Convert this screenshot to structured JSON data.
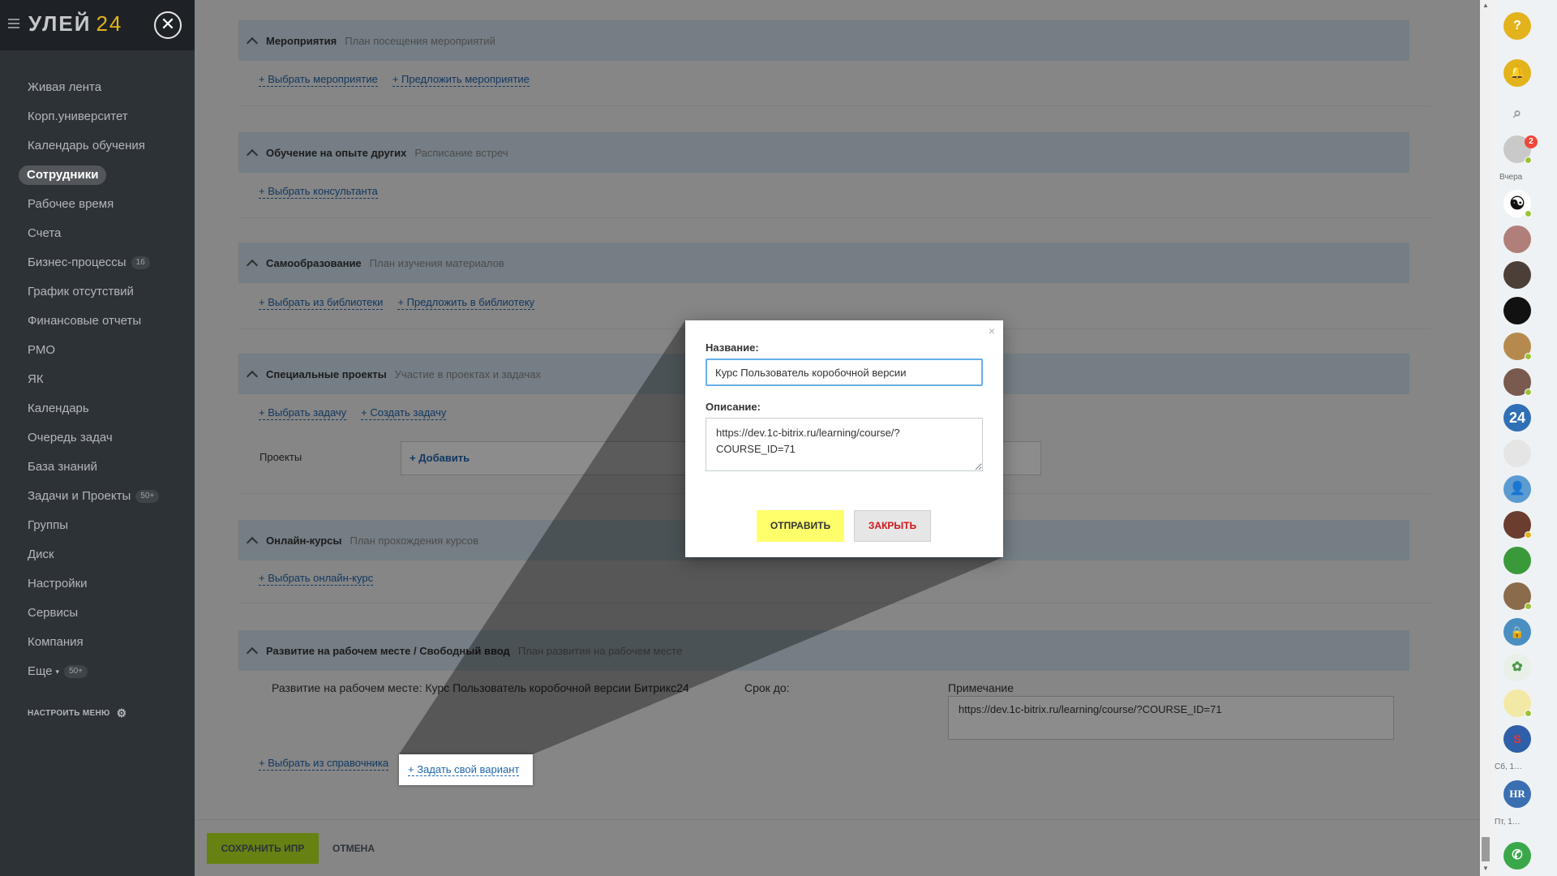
{
  "sidebar": {
    "logo_text": "УЛЕЙ",
    "logo_num": "24",
    "items": [
      {
        "label": "Живая лента"
      },
      {
        "label": "Корп.университет"
      },
      {
        "label": "Календарь обучения"
      },
      {
        "label": "Сотрудники",
        "active": true
      },
      {
        "label": "Рабочее время"
      },
      {
        "label": "Счета"
      },
      {
        "label": "Бизнес-процессы",
        "count": "16"
      },
      {
        "label": "График отсутствий"
      },
      {
        "label": "Финансовые отчеты"
      },
      {
        "label": "РМО"
      },
      {
        "label": "ЯК"
      },
      {
        "label": "Календарь"
      },
      {
        "label": "Очередь задач"
      },
      {
        "label": "База знаний"
      },
      {
        "label": "Задачи и Проекты",
        "count": "50+"
      },
      {
        "label": "Группы"
      },
      {
        "label": "Диск"
      },
      {
        "label": "Настройки"
      },
      {
        "label": "Сервисы"
      },
      {
        "label": "Компания"
      },
      {
        "label": "Еще",
        "count": "50+",
        "arrow": true
      }
    ],
    "settings_label": "НАСТРОИТЬ МЕНЮ"
  },
  "sections": {
    "events": {
      "title": "Мероприятия",
      "sub": "План посещения мероприятий",
      "link1": "+ Выбрать мероприятие",
      "link2": "+ Предложить мероприятие"
    },
    "learning": {
      "title": "Обучение на опыте других",
      "sub": "Расписание встреч",
      "link1": "+ Выбрать консультанта"
    },
    "self": {
      "title": "Самообразование",
      "sub": "План изучения материалов",
      "link1": "+ Выбрать из библиотеки",
      "link2": "+ Предложить в библиотеку"
    },
    "special": {
      "title": "Специальные проекты",
      "sub": "Участие в проектах и задачах",
      "link1": "+ Выбрать задачу",
      "link2": "+ Создать задачу",
      "projects_label": "Проекты",
      "add_label": "+ Добавить"
    },
    "online": {
      "title": "Онлайн-курсы",
      "sub": "План прохождения курсов",
      "link1": "+ Выбрать онлайн-курс"
    },
    "dev": {
      "title": "Развитие на рабочем месте / Свободный ввод",
      "sub": "План развития на рабочем месте",
      "item_text": "Развитие на рабочем месте: Курс Пользователь коробочной версии Битрикс24",
      "deadline_label": "Срок до:",
      "note_label": "Примечание",
      "note_value": "https://dev.1c-bitrix.ru/learning/course/?COURSE_ID=71",
      "link1": "+ Выбрать из справочника",
      "link2": "+ Задать свой вариант"
    }
  },
  "bottom": {
    "save": "СОХРАНИТЬ ИПР",
    "cancel": "ОТМЕНА"
  },
  "modal": {
    "name_label": "Название:",
    "name_value": "Курс Пользователь коробочной версии",
    "desc_label": "Описание:",
    "desc_value": "https://dev.1c-bitrix.ru/learning/course/?COURSE_ID=71",
    "send": "ОТПРАВИТЬ",
    "close": "ЗАКРЫТЬ",
    "close_x": "×"
  },
  "rightbar": {
    "help": "?",
    "yesterday_label": "Вчера",
    "badge": "2",
    "date1": "Сб, 1…",
    "date2": "Пт, 1…",
    "hr": "HR",
    "b24": "24"
  },
  "colors": {
    "accent": "#bbed21",
    "sidebar": "#2d3237",
    "link": "#2067b0",
    "section_header": "#d4e6f0"
  }
}
